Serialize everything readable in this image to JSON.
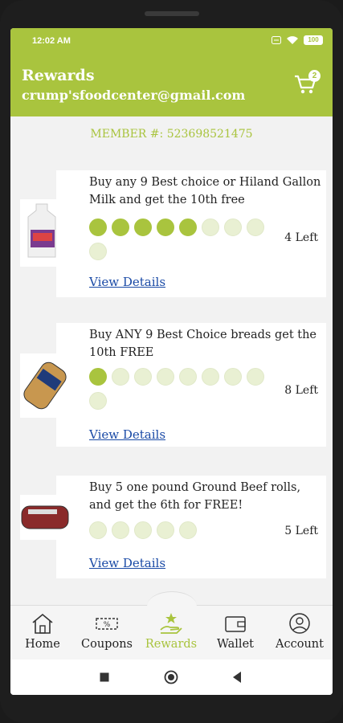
{
  "status": {
    "time": "12:02 AM",
    "battery": "100"
  },
  "header": {
    "title": "Rewards",
    "email": "crump'sfoodcenter@gmail.com",
    "cart_count": "2"
  },
  "member": {
    "label": "MEMBER #: 523698521475"
  },
  "rewards": [
    {
      "text": "Buy any 9 Best choice or Hiland Gallon Milk and get the 10th free",
      "filled": 5,
      "total": 9,
      "left": "4 Left",
      "details": "View Details"
    },
    {
      "text": "Buy ANY 9 Best Choice breads get the 10th FREE",
      "filled": 1,
      "total": 9,
      "left": "8 Left",
      "details": "View Details"
    },
    {
      "text": "Buy 5 one pound Ground Beef rolls, and get the 6th for FREE!",
      "filled": 0,
      "total": 5,
      "left": "5 Left",
      "details": "View Details"
    }
  ],
  "tabs": [
    {
      "label": "Home",
      "icon": "home-icon"
    },
    {
      "label": "Coupons",
      "icon": "coupon-icon"
    },
    {
      "label": "Rewards",
      "icon": "rewards-icon",
      "active": true
    },
    {
      "label": "Wallet",
      "icon": "wallet-icon"
    },
    {
      "label": "Account",
      "icon": "account-icon"
    }
  ],
  "colors": {
    "accent": "#a9c43e",
    "link": "#1a4aa6"
  }
}
